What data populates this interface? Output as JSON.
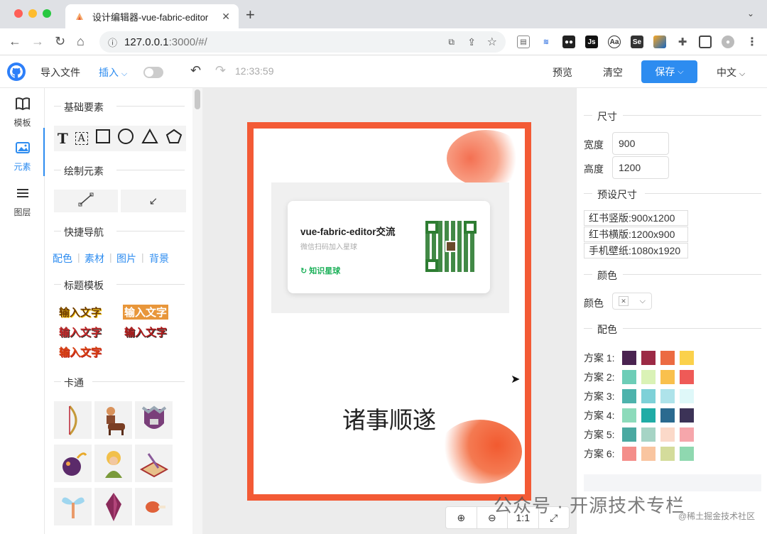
{
  "browser": {
    "tab_title": "设计编辑器-vue-fabric-editor",
    "new_tab": "+",
    "url_host": "127.0.0.1",
    "url_path": ":3000/#/"
  },
  "toolbar": {
    "import_label": "导入文件",
    "insert_label": "插入",
    "time": "12:33:59",
    "preview_label": "预览",
    "clear_label": "清空",
    "save_label": "保存",
    "lang_label": "中文"
  },
  "rail": {
    "items": [
      {
        "label": "模板",
        "icon": "book-icon"
      },
      {
        "label": "元素",
        "icon": "image-icon"
      },
      {
        "label": "图层",
        "icon": "layers-icon"
      }
    ]
  },
  "panel": {
    "basic_title": "基础要素",
    "draw_title": "绘制元素",
    "quick_title": "快捷导航",
    "quick_links": [
      "配色",
      "素材",
      "图片",
      "背景"
    ],
    "title_tpl_title": "标题模板",
    "title_tpl_text": "输入文字",
    "cartoon_title": "卡通"
  },
  "canvas": {
    "card_title": "vue-fabric-editor交流",
    "card_sub": "微信扫码加入星球",
    "card_brand": "知识星球",
    "greeting": "诸事顺遂",
    "zoom_ratio": "1:1"
  },
  "right": {
    "size_title": "尺寸",
    "width_label": "宽度",
    "width_value": "900",
    "height_label": "高度",
    "height_value": "1200",
    "preset_title": "预设尺寸",
    "presets": [
      "红书竖版:900x1200",
      "红书横版:1200x900",
      "手机壁纸:1080x1920"
    ],
    "color_title": "颜色",
    "color_label": "颜色",
    "palette_title": "配色",
    "schemes": [
      {
        "label": "方案 1:",
        "colors": [
          "#4a2350",
          "#9c2a45",
          "#ec6b42",
          "#fbd14b"
        ]
      },
      {
        "label": "方案 2:",
        "colors": [
          "#6dcdb7",
          "#daf2b6",
          "#f9c04d",
          "#ef5a57"
        ]
      },
      {
        "label": "方案 3:",
        "colors": [
          "#4db3ac",
          "#7ed1d8",
          "#aee3ea",
          "#dff8f9"
        ]
      },
      {
        "label": "方案 4:",
        "colors": [
          "#8ddbbb",
          "#20aca6",
          "#2b6a8f",
          "#3c3357"
        ]
      },
      {
        "label": "方案 5:",
        "colors": [
          "#4aa9a1",
          "#a6d4c5",
          "#fbd9c9",
          "#f6a6ab"
        ]
      },
      {
        "label": "方案 6:",
        "colors": [
          "#f48e8a",
          "#f9c5a0",
          "#d4dc9b",
          "#8fd8b0"
        ]
      }
    ]
  },
  "watermark": {
    "main": "公众号 · 开源技术专栏",
    "sub": "@稀土掘金技术社区"
  },
  "colors": {
    "accent": "#2d8cf0",
    "board_border": "#f35a35"
  }
}
